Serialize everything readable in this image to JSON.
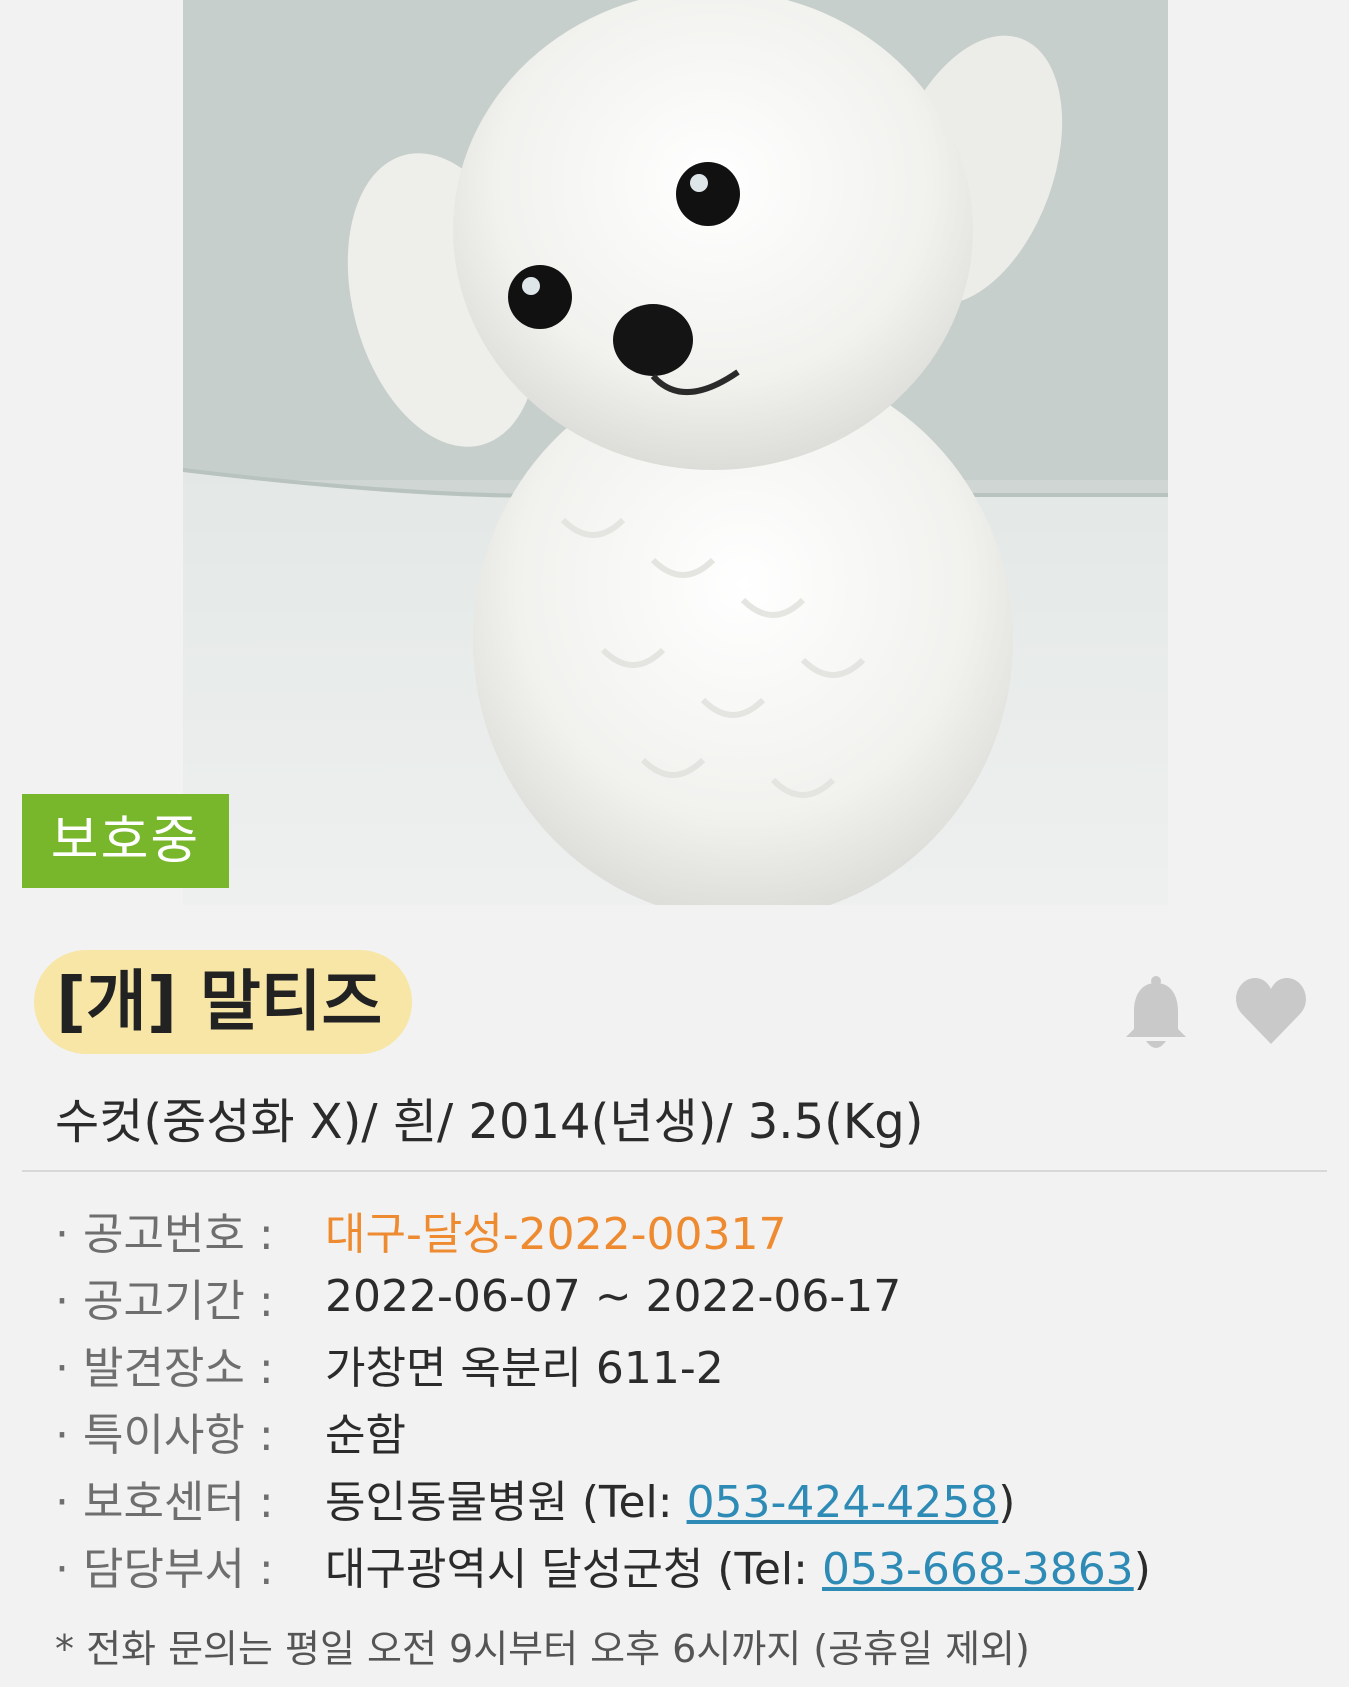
{
  "photo": {
    "subject": "white maltese dog",
    "status_label": "보호중",
    "status_color": "#78b62c"
  },
  "animal": {
    "title": "[개] 말티즈",
    "summary": "수컷(중성화 X)/ 흰/ 2014(년생)/ 3.5(Kg)"
  },
  "actions": {
    "bell_icon": "bell-icon",
    "heart_icon": "heart-icon"
  },
  "info": {
    "notice_no": {
      "label": "· 공고번호 :",
      "value": "대구-달성-2022-00317"
    },
    "period": {
      "label": "· 공고기간 :",
      "value": "2022-06-07 ~ 2022-06-17"
    },
    "place": {
      "label": "· 발견장소 :",
      "value": "가창면 옥분리 611-2"
    },
    "feature": {
      "label": "· 특이사항 :",
      "value": "순함"
    },
    "center": {
      "label": "· 보호센터 :",
      "name": "동인동물병원",
      "tel_prefix": " (Tel: ",
      "tel": "053-424-4258",
      "tel_suffix": ")"
    },
    "department": {
      "label": "· 담당부서 :",
      "name": "대구광역시 달성군청",
      "tel_prefix": " (Tel: ",
      "tel": "053-668-3863",
      "tel_suffix": ")"
    }
  },
  "notice": "* 전화 문의는 평일 오전 9시부터 오후 6시까지 (공휴일 제외)",
  "colors": {
    "accent_orange": "#ee8a2f",
    "link_blue": "#2e8bb6",
    "title_pill": "#f7e6a6"
  }
}
